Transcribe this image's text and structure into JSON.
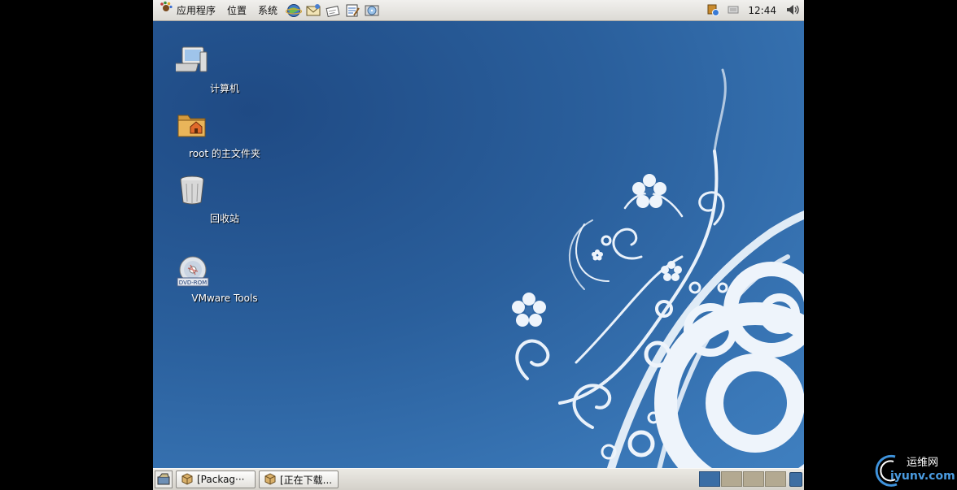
{
  "top_panel": {
    "menus": [
      "应用程序",
      "位置",
      "系统"
    ],
    "launchers": [
      "browser-icon",
      "mail-icon",
      "note-icon",
      "text-editor-icon",
      "disc-icon"
    ],
    "clock": "12:44",
    "tray_icons": [
      "update-icon",
      "network-icon",
      "volume-icon"
    ]
  },
  "desktop": {
    "icons": [
      {
        "label": "计算机",
        "icon": "computer-icon"
      },
      {
        "label": "root 的主文件夹",
        "icon": "home-folder-icon"
      },
      {
        "label": "回收站",
        "icon": "trash-icon"
      },
      {
        "label": "VMware Tools",
        "icon": "dvd-icon",
        "badge": "DVD-ROM"
      }
    ]
  },
  "taskbar": {
    "tasks": [
      {
        "label": "[Packag···",
        "icon": "package-icon"
      },
      {
        "label": "[正在下载...",
        "icon": "package-icon"
      }
    ],
    "workspaces": 4,
    "active_workspace": 1
  },
  "watermark": {
    "top": "运维网",
    "bottom": "iyunv.com"
  },
  "colors": {
    "desktop_blue": "#24578f",
    "panel": "#dcdad5",
    "workspace_active": "#3b6ea5"
  }
}
